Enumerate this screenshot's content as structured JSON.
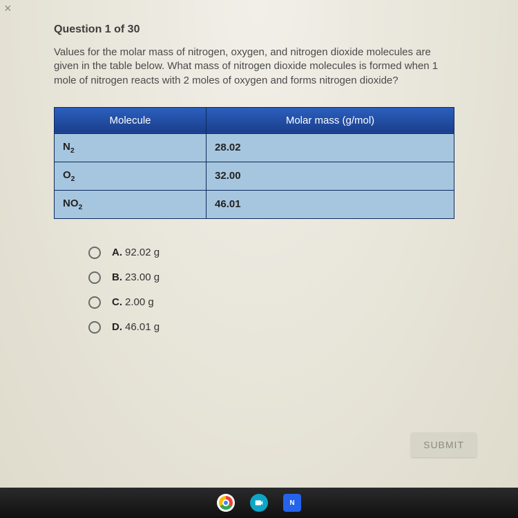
{
  "header": "Question 1 of 30",
  "prompt": "Values for the molar mass of nitrogen, oxygen, and nitrogen dioxide molecules are given in the table below. What mass of nitrogen dioxide molecules is formed when 1 mole of nitrogen reacts with 2 moles of oxygen and forms nitrogen dioxide?",
  "table": {
    "col1": "Molecule",
    "col2": "Molar mass (g/mol)",
    "rows": [
      {
        "label_base": "N",
        "label_sub": "2",
        "value": "28.02"
      },
      {
        "label_base": "O",
        "label_sub": "2",
        "value": "32.00"
      },
      {
        "label_base": "NO",
        "label_sub": "2",
        "value": "46.01"
      }
    ]
  },
  "options": [
    {
      "letter": "A.",
      "text": "92.02 g"
    },
    {
      "letter": "B.",
      "text": "23.00 g"
    },
    {
      "letter": "C.",
      "text": "2.00 g"
    },
    {
      "letter": "D.",
      "text": "46.01 g"
    }
  ],
  "submit": "SUBMIT",
  "docs_label": "N"
}
